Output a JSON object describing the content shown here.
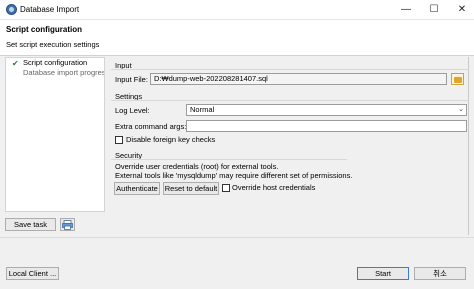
{
  "window": {
    "title": "Database Import",
    "minimize": "—",
    "maximize": "☐",
    "close": "✕"
  },
  "header": {
    "title": "Script configuration",
    "description": "Set script execution settings"
  },
  "nav": {
    "items": [
      {
        "label": "Script configuration",
        "checked": true
      },
      {
        "label": "Database import progress",
        "checked": false
      }
    ]
  },
  "left_buttons": {
    "save_task": "Save task"
  },
  "input_section": {
    "title": "Input",
    "input_file_label": "Input File:",
    "input_file_value": "D:₩dump-web-202208281407.sql"
  },
  "settings_section": {
    "title": "Settings",
    "log_level_label": "Log Level:",
    "log_level_value": "Normal",
    "extra_args_label": "Extra command args:",
    "extra_args_value": "",
    "disable_fk_label": "Disable foreign key checks",
    "disable_fk_checked": false
  },
  "security_section": {
    "title": "Security",
    "line1": "Override user credentials (root) for external tools.",
    "line2": "External tools like 'mysqldump' may require different set of permissions.",
    "authenticate_label": "Authenticate",
    "reset_label": "Reset to default",
    "override_label": "Override host credentials",
    "override_checked": false
  },
  "footer": {
    "local_client": "Local Client ...",
    "start": "Start",
    "cancel": "취소"
  },
  "colors": {
    "accent": "#3d7bd8",
    "folder": "#e3a32b",
    "check": "#2a7a3a"
  }
}
